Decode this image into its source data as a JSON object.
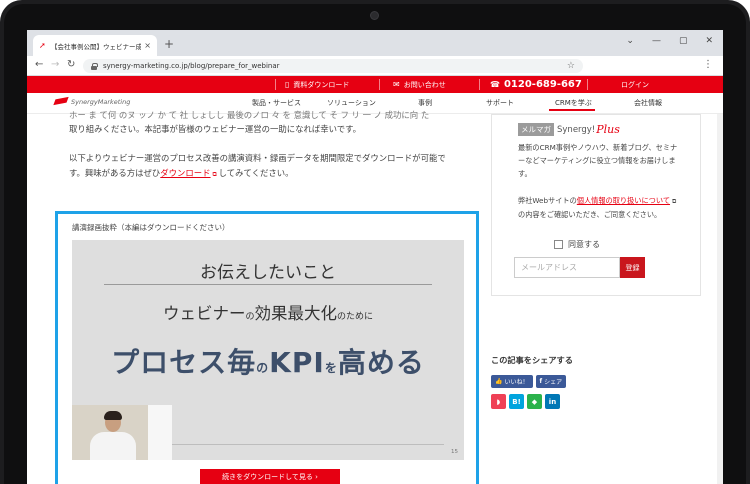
{
  "browser": {
    "tab_title": "【会社事例公開】ウェビナー成功に向",
    "tab_close": "×",
    "new_tab": "+",
    "url": "synergy-marketing.co.jp/blog/prepare_for_webinar",
    "window_controls": [
      "⌄",
      "—",
      "▢",
      "✕"
    ]
  },
  "topbar": {
    "brochure": "資料ダウンロード",
    "contact": "お問い合わせ",
    "phone": "0120-689-667",
    "login": "ログイン"
  },
  "nav": {
    "logo": "SynergyMarketing",
    "items": [
      "製品・サービス",
      "ソリューション",
      "事例",
      "サポート",
      "CRMを学ぶ",
      "会社情報"
    ],
    "active_index": 4
  },
  "article": {
    "cut_line": "ホー ま て何 のヌ ッノ か て 社 しょしし 最後のノロ 々 を 意識して そ フ リ 一 ノ 成功に向 た",
    "line2": "取り組みください。本記事が皆様のウェビナー運営の一助になれば幸いです。",
    "line3": "以下よりウェビナー運営のプロセス改善の講演資料・録画データを期間限定でダウンロードが可能で",
    "line4_before": "す。興味がある方はぜひ",
    "line4_link": "ダウンロード",
    "line4_after": "してみてください。"
  },
  "video": {
    "caption": "講演録画抜粋（本編はダウンロードください）",
    "slide_title": "お伝えしたいこと",
    "slide_sub_a": "ウェビナー",
    "slide_sub_no": "の",
    "slide_sub_b": "効果最大化",
    "slide_sub_c": "のために",
    "slide_big_a": "プロセス毎",
    "slide_big_no": "の",
    "slide_big_b": "KPI",
    "slide_big_wo": "を",
    "slide_big_c": "高める",
    "page_number": "15",
    "download_button": "続きをダウンロードして見る ›"
  },
  "sidebar": {
    "mm_badge": "メルマガ",
    "mm_name": "Synergy!",
    "mm_plus": "Plus",
    "mm_desc": "最新のCRM事例やノウハウ、新着ブログ、セミナーなどマーケティングに役立つ情報をお届けします。",
    "privacy_before": "弊社Webサイトの",
    "privacy_link": "個人情報の取り扱いについて",
    "privacy_after": "の内容をご確認いただき、ご同意ください。",
    "agree_label": "同意する",
    "email_placeholder": "メールアドレス",
    "register_button": "登録",
    "share_title": "この記事をシェアする",
    "fb_like": "いいね！",
    "fb_share": "シェア",
    "share_icons": [
      {
        "name": "pocket",
        "glyph": "◗",
        "color": "#ef4056"
      },
      {
        "name": "hatena",
        "glyph": "B!",
        "color": "#00a4de"
      },
      {
        "name": "feedly",
        "glyph": "◆",
        "color": "#2bb24c"
      },
      {
        "name": "linkedin",
        "glyph": "in",
        "color": "#0077b5"
      }
    ]
  },
  "colors": {
    "brand_red": "#e60012",
    "highlight_blue": "#1ea2e8",
    "facebook": "#3b5998"
  }
}
